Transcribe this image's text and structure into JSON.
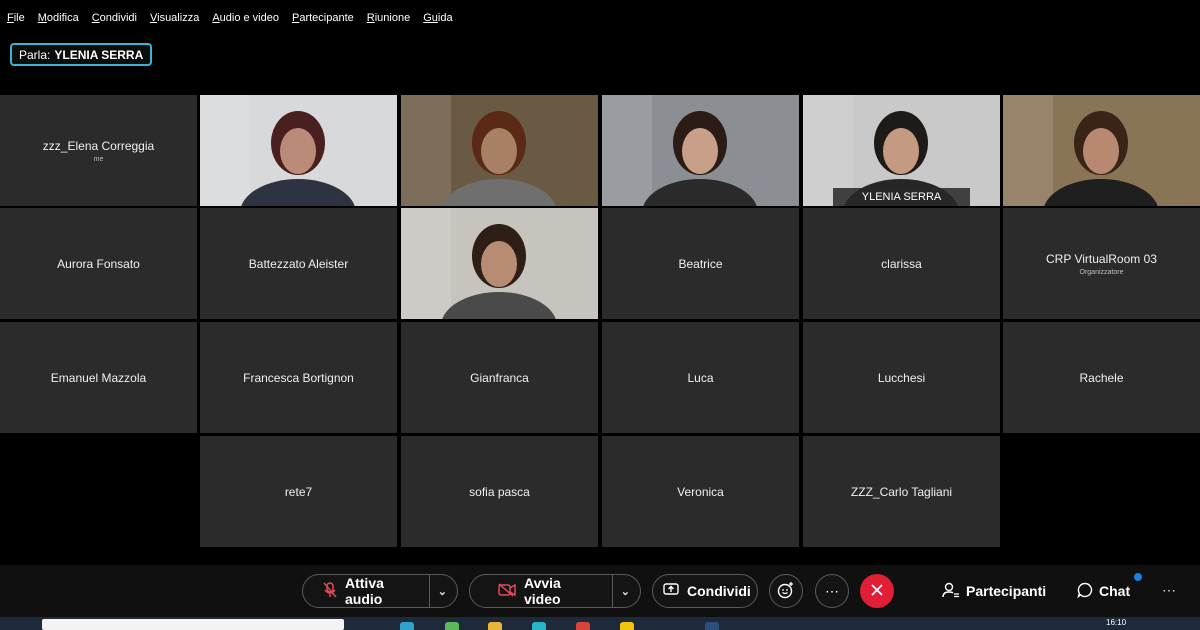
{
  "menu": {
    "items": [
      {
        "accel": "F",
        "rest": "ile"
      },
      {
        "accel": "M",
        "rest": "odifica"
      },
      {
        "accel": "C",
        "rest": "ondividi"
      },
      {
        "accel": "V",
        "rest": "isualizza"
      },
      {
        "accel": "A",
        "rest": "udio e video"
      },
      {
        "accel": "P",
        "rest": "artecipante"
      },
      {
        "accel": "R",
        "rest": "iunione"
      },
      {
        "accel": "Gu",
        "rest": "ida"
      }
    ]
  },
  "speaker": {
    "prefix": "Parla:",
    "name": "YLENIA SERRA"
  },
  "tiles": [
    {
      "name": "zzz_Elena Correggia",
      "sub": "me",
      "video": false
    },
    {
      "name": "",
      "video": true,
      "skin": "#b98b78",
      "hair": "#4a1f1f",
      "bg": "#d7d9da",
      "shirt": "#2d3340"
    },
    {
      "name": "",
      "video": true,
      "skin": "#a88063",
      "hair": "#5a2a16",
      "bg": "#6b5a43",
      "shirt": "#6f6f6f"
    },
    {
      "name": "",
      "video": true,
      "skin": "#c8a08a",
      "hair": "#2b1c16",
      "bg": "#8b8f94",
      "shirt": "#2a2a2a"
    },
    {
      "name": "YLENIA SERRA",
      "video": true,
      "active": true,
      "skin": "#c49a82",
      "hair": "#1e1a18",
      "bg": "#c9c9c9",
      "shirt": "#262626"
    },
    {
      "name": "",
      "video": true,
      "skin": "#b98870",
      "hair": "#3a2418",
      "bg": "#8a7456",
      "shirt": "#1f1f1f"
    },
    {
      "name": "Aurora Fonsato",
      "video": false
    },
    {
      "name": "Battezzato Aleister",
      "video": false
    },
    {
      "name": "",
      "video": true,
      "skin": "#b78c73",
      "hair": "#2f1e16",
      "bg": "#c7c4bd",
      "shirt": "#4a4a4a"
    },
    {
      "name": "Beatrice",
      "video": false
    },
    {
      "name": "clarissa",
      "video": false
    },
    {
      "name": "CRP VirtualRoom 03",
      "sub": "Organizzatore",
      "video": false
    },
    {
      "name": "Emanuel Mazzola",
      "video": false
    },
    {
      "name": "Francesca Bortignon",
      "video": false
    },
    {
      "name": "Gianfranca",
      "video": false
    },
    {
      "name": "Luca",
      "video": false
    },
    {
      "name": "Lucchesi",
      "video": false
    },
    {
      "name": "Rachele",
      "video": false
    },
    {
      "name": "rete7",
      "video": false
    },
    {
      "name": "sofia pasca",
      "video": false
    },
    {
      "name": "Veronica",
      "video": false
    },
    {
      "name": "ZZZ_Carlo Tagliani",
      "video": false
    }
  ],
  "toolbar": {
    "audio_label": "Attiva audio",
    "video_label": "Avvia video",
    "share_label": "Condividi",
    "participants_label": "Partecipanti",
    "chat_label": "Chat",
    "icons": [
      "mic-muted-icon",
      "camera-off-icon",
      "share-screen-icon",
      "reactions-icon",
      "more-icon",
      "leave-icon",
      "participants-icon",
      "chat-icon"
    ],
    "leave_color": "#e01e35",
    "accent": "#1fb5e8"
  },
  "taskbar": {
    "time": "16:10"
  }
}
